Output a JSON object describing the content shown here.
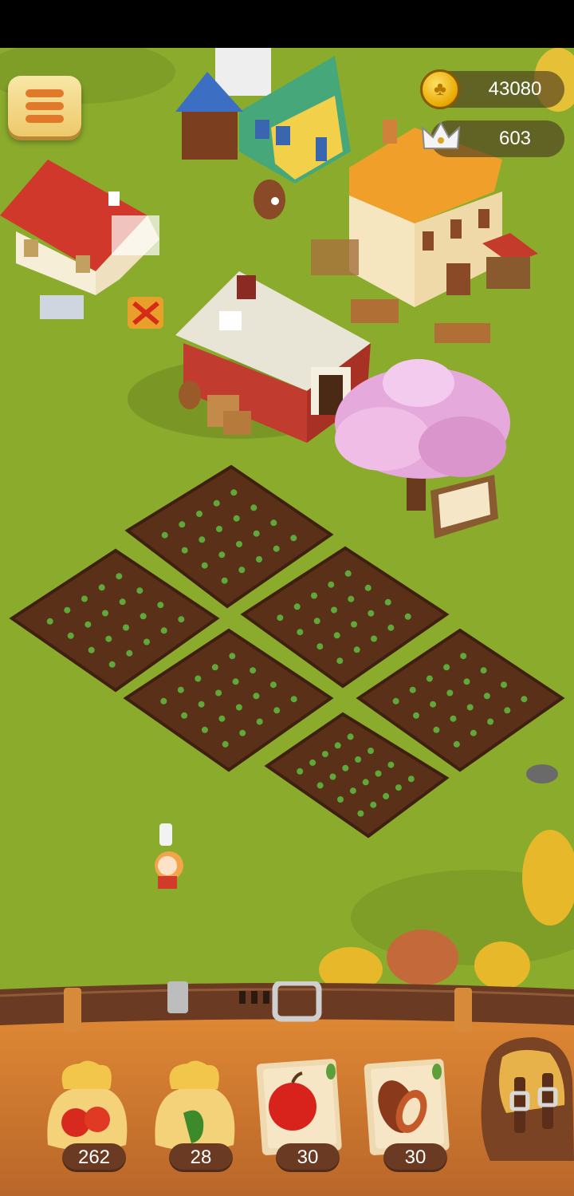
{
  "hud": {
    "menu_icon": "hamburger-menu-icon",
    "coins": {
      "icon": "gold-coin-icon",
      "value": "43080"
    },
    "crowns": {
      "icon": "crown-icon",
      "value": "603"
    }
  },
  "inventory": {
    "items": [
      {
        "name": "tomato-seed-bag",
        "icon": "tomato-seed-bag-icon",
        "count": "262"
      },
      {
        "name": "pepper-seed-bag",
        "icon": "pepper-seed-bag-icon",
        "count": "28"
      },
      {
        "name": "apple-seed-packet",
        "icon": "apple-packet-icon",
        "count": "30"
      },
      {
        "name": "cocoa-seed-packet",
        "icon": "cocoa-packet-icon",
        "count": "30"
      }
    ],
    "backpack_icon": "backpack-icon"
  },
  "colors": {
    "grass": "#8bab2d",
    "soil": "#5a3118",
    "belt": "#6b3a22",
    "dock": "#c9772f",
    "blossom": "#e6a9dc"
  }
}
